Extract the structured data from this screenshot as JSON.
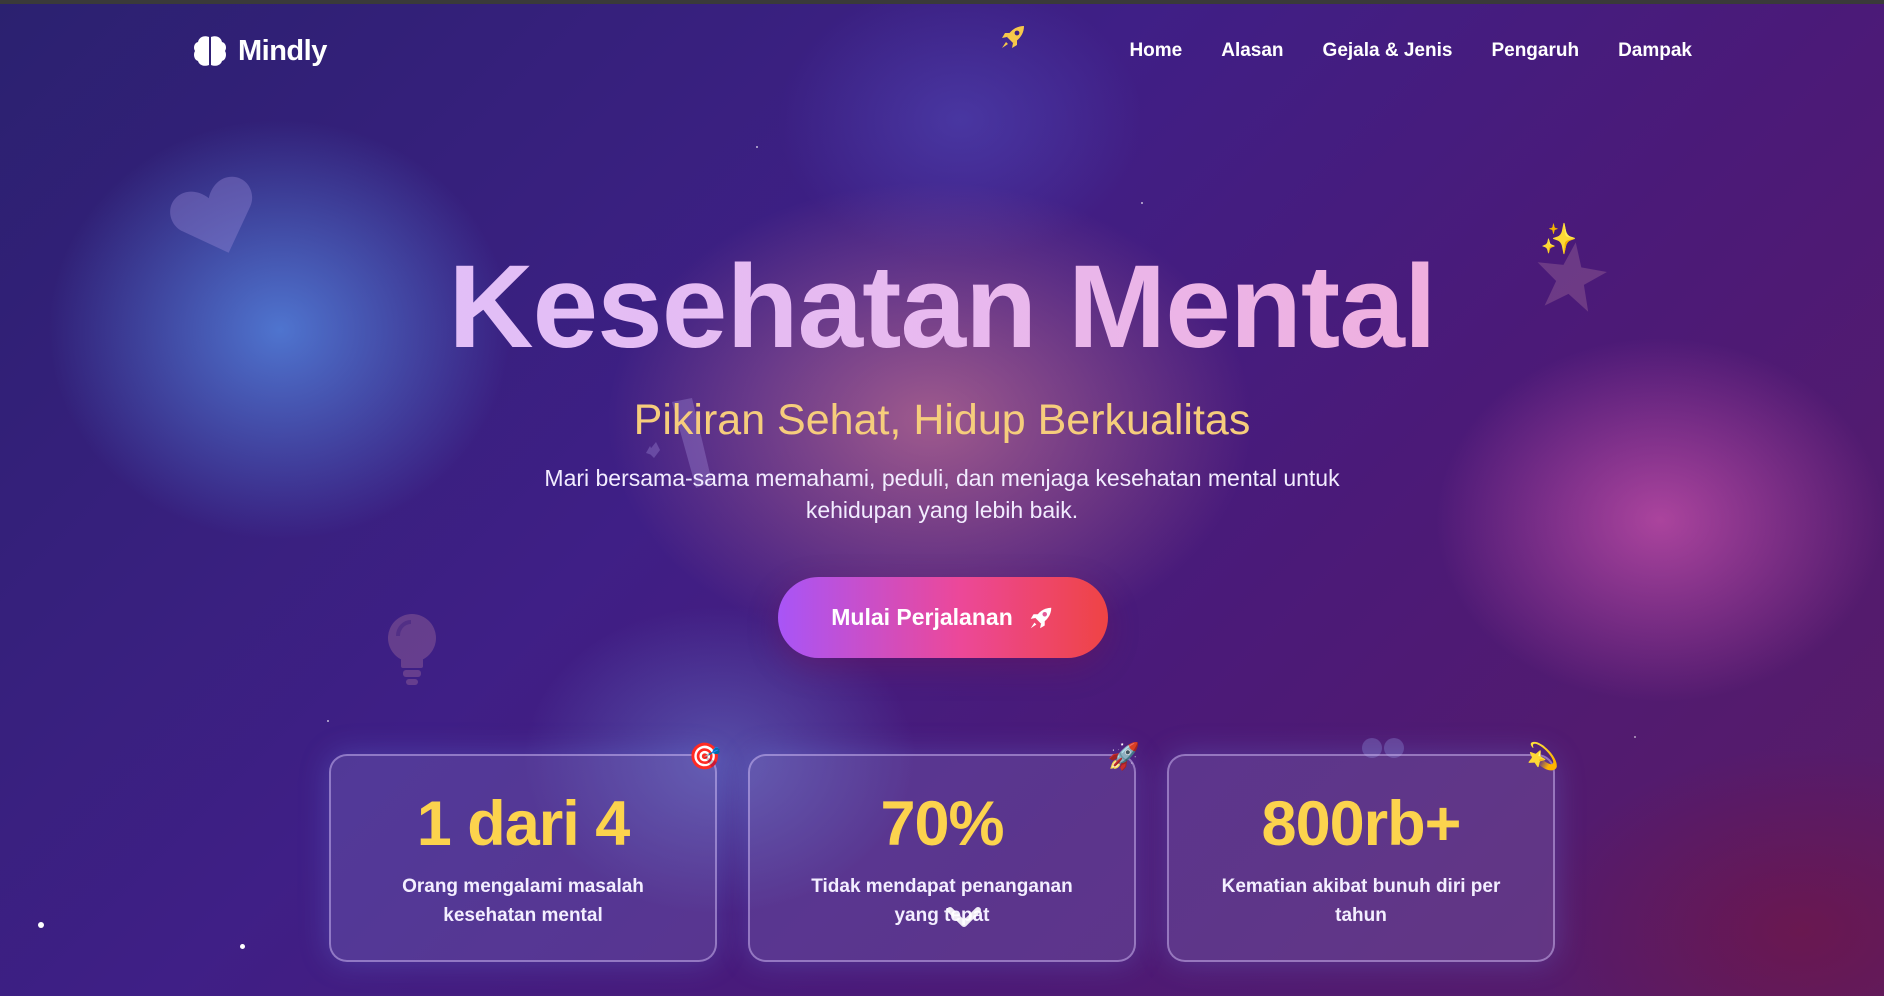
{
  "brand": {
    "name": "Mindly",
    "logo_icon": "brain-icon"
  },
  "nav": {
    "items": [
      {
        "label": "Home"
      },
      {
        "label": "Alasan"
      },
      {
        "label": "Gejala & Jenis"
      },
      {
        "label": "Pengaruh"
      },
      {
        "label": "Dampak"
      }
    ]
  },
  "hero": {
    "title": "Kesehatan Mental",
    "subtitle": "Pikiran Sehat, Hidup Berkualitas",
    "description": "Mari bersama-sama memahami, peduli, dan menjaga kesehatan mental untuk kehidupan yang lebih baik.",
    "cta_label": "Mulai Perjalanan",
    "cta_icon": "rocket-icon"
  },
  "stats": [
    {
      "value": "1 dari 4",
      "label": "Orang mengalami masalah kesehatan mental",
      "emoji": "🎯"
    },
    {
      "value": "70%",
      "label": "Tidak mendapat penanganan yang tepat",
      "emoji": "🚀"
    },
    {
      "value": "800rb+",
      "label": "Kematian akibat bunuh diri per tahun",
      "emoji": "💫"
    }
  ],
  "decorations": {
    "sparkle": "✨",
    "floating_icon": "rocket-icon"
  },
  "colors": {
    "accent_gold": "#fcd34d",
    "subtitle": "#f6cd7c",
    "cta_start": "#a855f7",
    "cta_mid": "#ec4899",
    "cta_end": "#ef4444",
    "bg_deep": "#3f1f86"
  }
}
